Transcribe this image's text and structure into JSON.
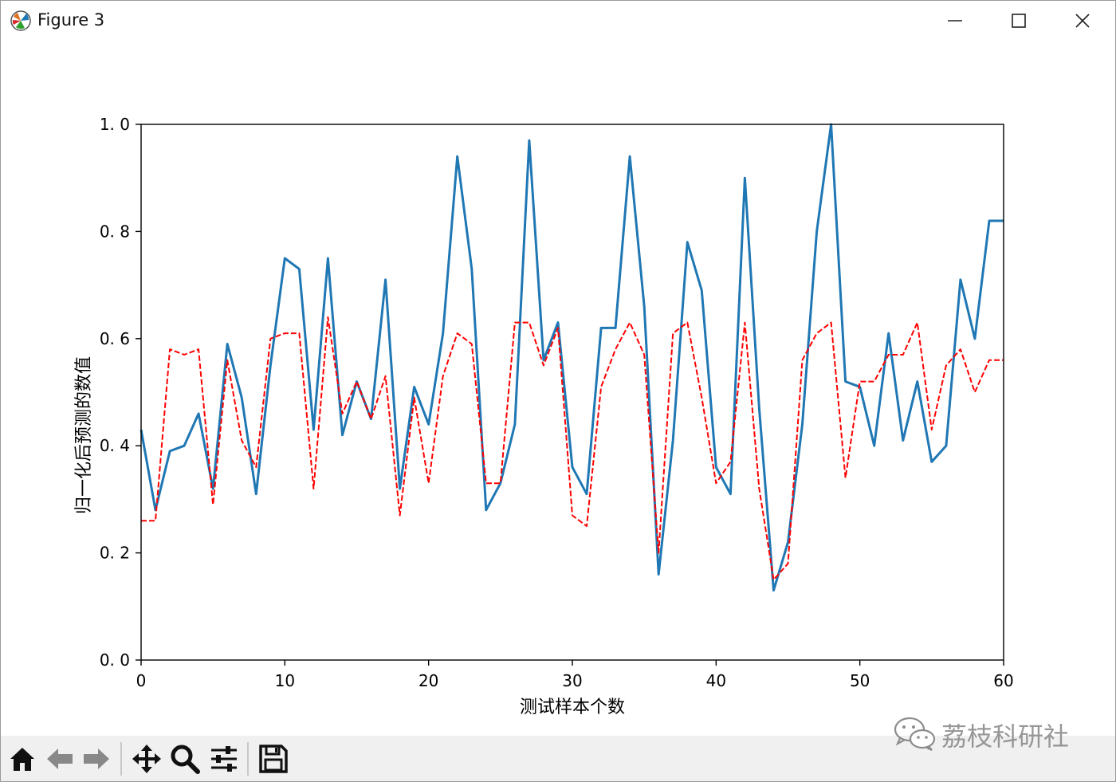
{
  "window": {
    "title": "Figure 3",
    "minimize_glyph": "minimize-icon",
    "maximize_glyph": "maximize-icon",
    "close_glyph": "close-icon"
  },
  "toolbar": {
    "buttons": [
      "home-icon",
      "back-icon",
      "forward-icon",
      "pan-icon",
      "zoom-icon",
      "configure-subplots-icon",
      "save-icon"
    ]
  },
  "watermark": {
    "text": "荔枝科研社",
    "icon": "wechat-icon"
  },
  "colors": {
    "series_actual": "#1f77b4",
    "series_predicted": "#ff0000"
  },
  "chart_data": {
    "type": "line",
    "title": "",
    "xlabel": "测试样本个数",
    "ylabel": "归一化后预测的数值",
    "xlim": [
      0,
      60
    ],
    "ylim": [
      0.0,
      1.0
    ],
    "x_ticks": [
      0,
      10,
      20,
      30,
      40,
      50,
      60
    ],
    "x_tick_labels": [
      "0",
      "10",
      "20",
      "30",
      "40",
      "50",
      "60"
    ],
    "y_ticks": [
      0.0,
      0.2,
      0.4,
      0.6,
      0.8,
      1.0
    ],
    "y_tick_labels": [
      "0. 0",
      "0. 2",
      "0. 4",
      "0. 6",
      "0. 8",
      "1. 0"
    ],
    "grid": false,
    "x": [
      0,
      1,
      2,
      3,
      4,
      5,
      6,
      7,
      8,
      9,
      10,
      11,
      12,
      13,
      14,
      15,
      16,
      17,
      18,
      19,
      20,
      21,
      22,
      23,
      24,
      25,
      26,
      27,
      28,
      29,
      30,
      31,
      32,
      33,
      34,
      35,
      36,
      37,
      38,
      39,
      40,
      41,
      42,
      43,
      44,
      45,
      46,
      47,
      48,
      49,
      50,
      51,
      52,
      53,
      54,
      55,
      56,
      57,
      58,
      59,
      60
    ],
    "series": [
      {
        "style": "solid",
        "values": [
          0.43,
          0.28,
          0.39,
          0.4,
          0.46,
          0.32,
          0.59,
          0.49,
          0.31,
          0.55,
          0.75,
          0.73,
          0.43,
          0.75,
          0.42,
          0.52,
          0.45,
          0.71,
          0.32,
          0.51,
          0.44,
          0.61,
          0.94,
          0.73,
          0.28,
          0.33,
          0.44,
          0.97,
          0.56,
          0.63,
          0.36,
          0.31,
          0.62,
          0.62,
          0.94,
          0.66,
          0.16,
          0.41,
          0.78,
          0.69,
          0.36,
          0.31,
          0.9,
          0.47,
          0.13,
          0.22,
          0.44,
          0.8,
          1.0,
          0.52,
          0.51,
          0.4,
          0.61,
          0.41,
          0.52,
          0.37,
          0.4,
          0.71,
          0.6,
          0.82,
          0.82
        ]
      },
      {
        "style": "dashed",
        "values": [
          0.26,
          0.26,
          0.58,
          0.57,
          0.58,
          0.29,
          0.56,
          0.41,
          0.36,
          0.6,
          0.61,
          0.61,
          0.32,
          0.64,
          0.46,
          0.52,
          0.45,
          0.53,
          0.27,
          0.49,
          0.33,
          0.53,
          0.61,
          0.59,
          0.33,
          0.33,
          0.63,
          0.63,
          0.55,
          0.62,
          0.27,
          0.25,
          0.51,
          0.58,
          0.63,
          0.57,
          0.2,
          0.61,
          0.63,
          0.49,
          0.33,
          0.37,
          0.63,
          0.32,
          0.15,
          0.18,
          0.56,
          0.61,
          0.63,
          0.34,
          0.52,
          0.52,
          0.57,
          0.57,
          0.63,
          0.43,
          0.55,
          0.58,
          0.5,
          0.56,
          0.56
        ]
      }
    ]
  }
}
